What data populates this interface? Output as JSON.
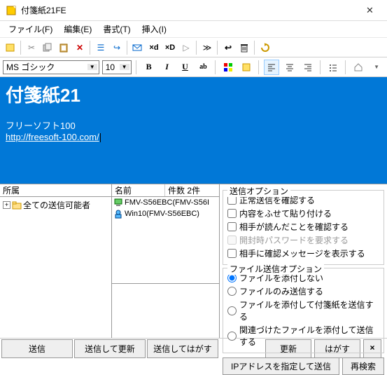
{
  "window": {
    "title": "付箋紙21FE"
  },
  "menu": {
    "file": "ファイル(F)",
    "edit": "編集(E)",
    "format": "書式(T)",
    "insert": "挿入(I)"
  },
  "format": {
    "font_name": "MS ゴシック",
    "font_size": "10"
  },
  "editor": {
    "title": "付箋紙21",
    "line2": "フリーソフト100",
    "url": "http://freesoft-100.com/"
  },
  "left": {
    "header": "所属",
    "root": "全ての送信可能者"
  },
  "mid": {
    "col_name": "名前",
    "col_count": "件数",
    "count_val": "2件",
    "rows": [
      {
        "label": "FMV-S56EBC(FMV-S56I"
      },
      {
        "label": "Win10(FMV-S56EBC)"
      }
    ]
  },
  "send_opts": {
    "title": "送信オプション",
    "c1": "正常送信を確認する",
    "c2": "内容をふせて貼り付ける",
    "c3": "相手が読んだことを確認する",
    "c4": "開封時パスワードを要求する",
    "c5": "相手に確認メッセージを表示する"
  },
  "file_opts": {
    "title": "ファイル送信オプション",
    "r1": "ファイルを添付しない",
    "r2": "ファイルのみ送信する",
    "r3": "ファイルを添付して付箋紙を送信する",
    "r4": "関連づけたファイルを添付して送信する"
  },
  "btns": {
    "ip_send": "IPアドレスを指定して送信",
    "research": "再検索",
    "send": "送信",
    "send_update": "送信して更新",
    "send_remove": "送信してはがす",
    "update": "更新",
    "remove": "はがす",
    "close": "×"
  }
}
